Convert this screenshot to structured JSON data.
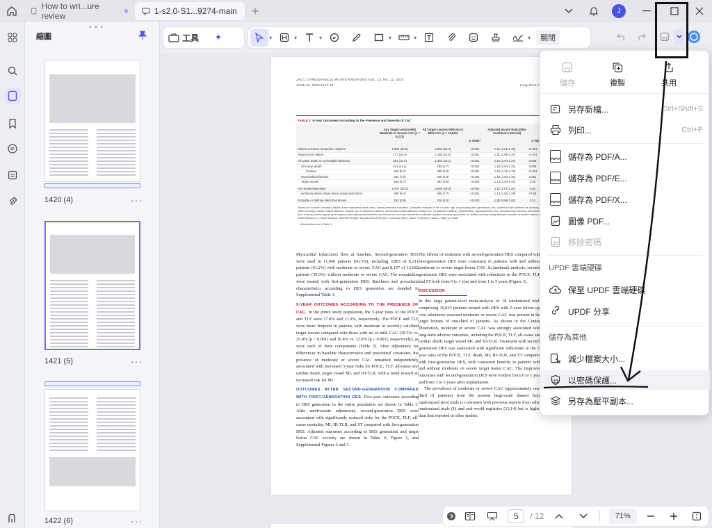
{
  "titlebar": {
    "tabs": [
      {
        "label": "How to wri...ure review"
      },
      {
        "label": "1-s2.0-S1...9274-main"
      }
    ],
    "avatar_letter": "J"
  },
  "sidebar": {
    "panel_title": "縮圖",
    "thumbnails": [
      {
        "label": "1420 (4)"
      },
      {
        "label": "1421 (5)"
      },
      {
        "label": "1422 (6)"
      }
    ]
  },
  "toolbar": {
    "tools_label": "工具",
    "close_label": "關閉"
  },
  "document": {
    "running_head_left": "JACC: CARDIOVASCULAR INTERVENTIONS VOL. 13, NO. 12, 2020",
    "running_head_left2": "JUNE 22, 2020:1417-28",
    "running_head_right": "Gue",
    "running_head_right2": "Long-Term Impact of DES in Calc",
    "table": {
      "label": "TABLE 2",
      "title": "5-Year Outcomes According to the Presence and Severity of CAC",
      "headers": [
        "Any Target Lesion With Moderate or Severe CAC (n = 6,211)",
        "All Target Lesions With No or Mild CAC (n = 13,622)",
        "p Value*",
        "Adjusted Hazard Ratio (95% Confidence Interval)",
        "p Value†"
      ],
      "rows": [
        [
          "Patient-oriented composite endpoint",
          "1,593 (30.5)",
          "2,958 (25.4)",
          "<0.001",
          "1.12 (1.05-1.20)",
          "<0.001"
        ],
        [
          "Target lesion failure",
          "717 (16.4)",
          "1,166 (12.0)",
          "<0.001",
          "1.21 (1.09-1.34)",
          "<0.001"
        ],
        [
          "All-cause death or myocardial infarction",
          "821 (16.4)",
          "1,343 (12.1)",
          "<0.001",
          "1.15 (1.04-1.27)",
          "0.006"
        ],
        [
          "All-cause death",
          "511 (11.1)",
          "785 (7.7)",
          "<0.001",
          "1.18 (1.04-1.34)",
          "0.008"
        ],
        [
          "Cardiac",
          "269 (5.7)",
          "339 (3.3)",
          "<0.001",
          "1.44 (1.20-1.72)",
          "<0.001"
        ],
        [
          "Myocardial infarction",
          "381 (7.0)",
          "649 (5.5)",
          "<0.001",
          "1.15 (1.00-1.33)",
          "0.051"
        ],
        [
          "Target vessel",
          "258 (5.7)",
          "393 (3.9)",
          "<0.001",
          "1.23 (1.03-1.47)",
          "0.02"
        ],
        [
          "Any revascularization",
          "1,037 (22.0)",
          "2,055 (19.4)",
          "<0.001",
          "1.11 (1.02-1.20)",
          "0.02"
        ],
        [
          "Ischemia-driven target lesion revascularization",
          "495 (9.4)",
          "908 (7.7)",
          "<0.001",
          "1.13 (1.00-1.28)",
          "0.045"
        ],
        [
          "Probable or definite stent thrombosis",
          "152 (2.9)",
          "236 (2.0)",
          "<0.001",
          "1.20 (0.96-1.51)",
          "0.11"
        ]
      ],
      "footnote": "Values are number of events (Kaplan-Meier estimated event rates), unless otherwise indicated. Covariates included in the models: age, drug-eluting stent generation, sex, current smoker (defined as smoking within 30 days), insulin-treated diabetes mellitus (vs. no diabetes mellitus), non-insulin-treated diabetes mellitus (vs. no diabetes mellitus), hypertension, hyperlipidemia, prior percutaneous coronary intervention, prior coronary artery bypass graft surgery, prior myocardial infarction, percutaneous coronary intervention indication (stable coronary syndromes vs. stable coronary artery disease), number of treated lesions (>1 lesion treated vs. 1 lesion treated), total stent length, and any ACC/AHA type C coronary artery lesion. *Log-rank p value. †Wald χ p value.",
      "abbrev": "Abbreviations as in Table 1."
    },
    "col_left": {
      "p1": "Myocardial Infarction) flow at baseline. Second-generation DES were used in 11,960 patients (60.3%), including 3,803 of 6,211 patients (61.2%) with moderate or severe CAC and 8,157 of 13,622 patients (59.9%) without moderate or severe CAC. The remainders were treated with first-generation DES. Baselines and procedural characteristics according to DES generation are detailed in Supplemental Table 3.",
      "h1": "5-YEAR OUTCOMES ACCORDING TO THE PRESENCE OF CAC.",
      "p2": "In the entire study population, the 5-year rates of the POCE and TLF were 27.0% and 13.3%, respectively. The POCE and TLF were more frequent in patients with moderate or severely calcified target lesions compared with those with no or mild CAC (30.5% vs. 25.4% [p < 0.001] and 16.4% vs. 12.0% [p < 0.001], respectively), as were each of their components (Table 2). After adjustment for differences in baseline characteristics and procedural covariates, the presence of moderate or severe CAC remained independently associated with increased 5-year risks for POCE, TLF, all-cause and cardiac death, target vessel MI, and ID-TLR, with a trend toward an increased risk for MI.",
      "h2": "OUTCOMES AFTER SECOND-GENERATION COMPARED WITH FIRST-GENERATION DES.",
      "p3": "Five-year outcomes according to DES generation in the entire population are shown in Table 3. After multivariate adjustment, second-generation DES were associated with significantly reduced risks for the POCE, TLF, all-cause mortality, MI, ID-TLR, and ST compared with first-generation DES. Adjusted outcomes according to DES generation and target lesion CAC severity are shown in Table 4, Figure 2, and Supplemental Figures 2 and 3."
    },
    "col_right": {
      "p1": "The effects of treatment with second-generation DES compared with first-generation DES were consistent in patients with and without moderate or severe target lesion CAC. In landmark analysis, second-generation DES were associated with reductions in the POCE, TLF, and ST both from 0 to 1 year and from 1 to 5 years (Figure 3).",
      "h1": "DISCUSSION",
      "p2": "In this large patient-level meta-analysis of 18 randomized trials comprising 19,833 patients treated with DES with 5-year follow-up, core laboratory-assessed moderate or severe CAC was present in the target lesions of one-third of patients. As shown in the Central Illustration, moderate or severe CAC was strongly associated with long-term adverse outcomes, including the POCE, TLF, all-cause and cardiac death, target vessel MI, and ID-TLR. Treatment with second-generation DES was associated with significant reductions in the 5-year rates of the POCE, TLF, death, MI, ID-TLR, and ST compared with first-generation DES, with consistent benefits in patients with and without moderate or severe target lesion CAC. The improved outcomes with second-generation DES were evident from 0 to 1 year and from 1 to 5 years after implantation.",
      "p3": "The prevalence of moderate or severe CAC (approximately one-third of patients) from the present large-scale dataset from randomized stent trials is consistent with previous reports from other randomized trials (1) and real-world registries (13,14) but is higher than that reported in other studies,"
    }
  },
  "menu": {
    "top": [
      {
        "label": "儲存",
        "icon": "save-icon",
        "disabled": true
      },
      {
        "label": "複製",
        "icon": "copy-plus-icon",
        "disabled": false
      },
      {
        "label": "共用",
        "icon": "share-icon",
        "disabled": false
      }
    ],
    "save_as_new": "另存新檔...",
    "save_as_new_shortcut": "Ctrl+Shift+S",
    "print": "列印...",
    "print_shortcut": "Ctrl+P",
    "pdfa": "儲存為 PDF/A...",
    "pdfe": "儲存為 PDF/E...",
    "pdfx": "儲存為 PDF/X...",
    "pdfa_badge": "PDF/A",
    "pdfe_badge": "PDF/E",
    "pdfx_badge": "PDF/X",
    "image_pdf": "圖像 PDF...",
    "remove_password": "移除密碼",
    "section_cloud": "UPDF 雲端硬碟",
    "save_cloud": "保至 UPDF 雲端硬碟",
    "updf_share": "UPDF 分享",
    "section_other": "儲存為其他",
    "reduce_size": "減少檔案大小...",
    "protect_password": "以密碼保護...",
    "flatten_copy": "另存為壓平副本..."
  },
  "bottombar": {
    "current_page": "5",
    "total_pages": "/ 12",
    "zoom": "71%"
  }
}
